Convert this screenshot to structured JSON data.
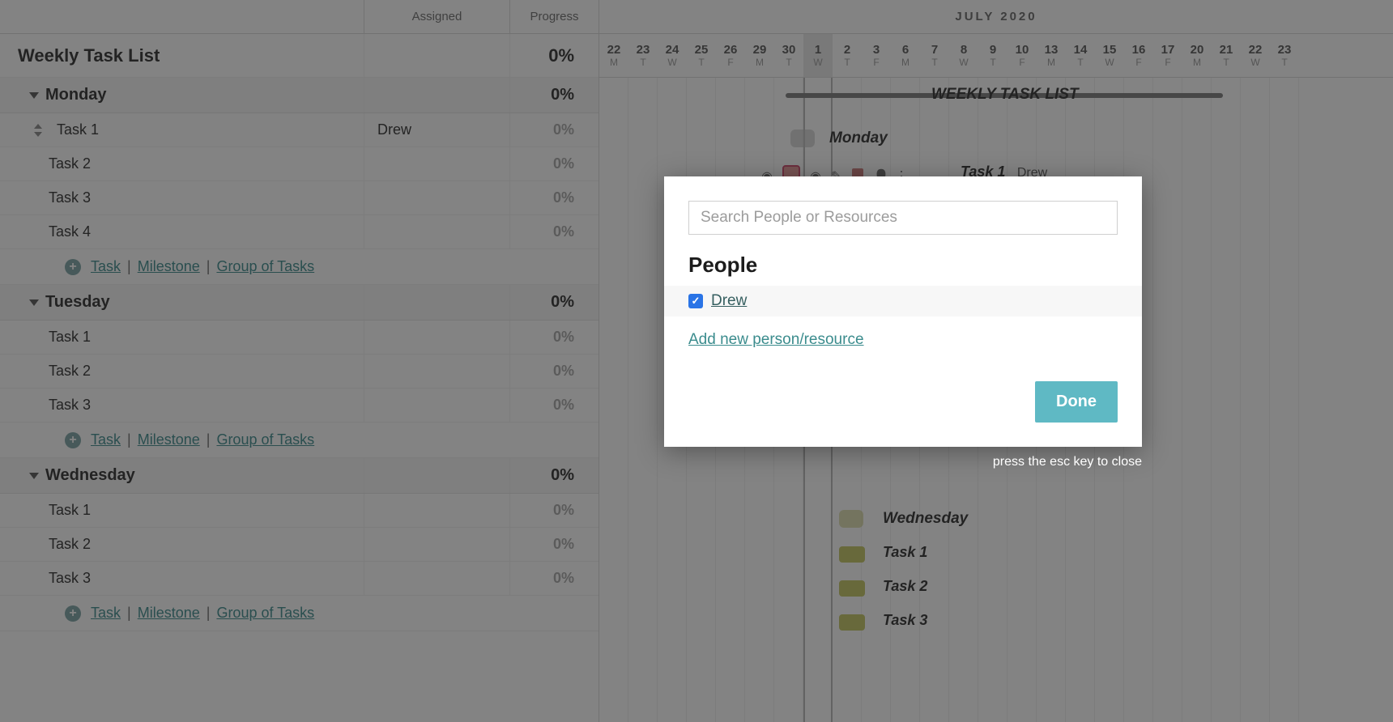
{
  "columns": {
    "assigned": "Assigned",
    "progress": "Progress"
  },
  "project": {
    "title": "Weekly Task List",
    "progress": "0%"
  },
  "days": [
    {
      "name": "Monday",
      "progress": "0%",
      "tasks": [
        {
          "name": "Task 1",
          "assigned": "Drew",
          "progress": "0%"
        },
        {
          "name": "Task 2",
          "assigned": "",
          "progress": "0%"
        },
        {
          "name": "Task 3",
          "assigned": "",
          "progress": "0%"
        },
        {
          "name": "Task 4",
          "assigned": "",
          "progress": "0%"
        }
      ]
    },
    {
      "name": "Tuesday",
      "progress": "0%",
      "tasks": [
        {
          "name": "Task 1",
          "assigned": "",
          "progress": "0%"
        },
        {
          "name": "Task 2",
          "assigned": "",
          "progress": "0%"
        },
        {
          "name": "Task 3",
          "assigned": "",
          "progress": "0%"
        }
      ]
    },
    {
      "name": "Wednesday",
      "progress": "0%",
      "tasks": [
        {
          "name": "Task 1",
          "assigned": "",
          "progress": "0%"
        },
        {
          "name": "Task 2",
          "assigned": "",
          "progress": "0%"
        },
        {
          "name": "Task 3",
          "assigned": "",
          "progress": "0%"
        }
      ]
    }
  ],
  "addRow": {
    "task": "Task",
    "milestone": "Milestone",
    "group": "Group of Tasks"
  },
  "timeline": {
    "month": "JULY 2020",
    "days": [
      {
        "n": "22",
        "w": "M"
      },
      {
        "n": "23",
        "w": "T"
      },
      {
        "n": "24",
        "w": "W"
      },
      {
        "n": "25",
        "w": "T"
      },
      {
        "n": "26",
        "w": "F"
      },
      {
        "n": "29",
        "w": "M"
      },
      {
        "n": "30",
        "w": "T"
      },
      {
        "n": "1",
        "w": "W"
      },
      {
        "n": "2",
        "w": "T"
      },
      {
        "n": "3",
        "w": "F"
      },
      {
        "n": "6",
        "w": "M"
      },
      {
        "n": "7",
        "w": "T"
      },
      {
        "n": "8",
        "w": "W"
      },
      {
        "n": "9",
        "w": "T"
      },
      {
        "n": "10",
        "w": "F"
      },
      {
        "n": "13",
        "w": "M"
      },
      {
        "n": "14",
        "w": "T"
      },
      {
        "n": "15",
        "w": "W"
      },
      {
        "n": "16",
        "w": "F"
      },
      {
        "n": "17",
        "w": "F"
      },
      {
        "n": "20",
        "w": "M"
      },
      {
        "n": "21",
        "w": "T"
      },
      {
        "n": "22",
        "w": "W"
      },
      {
        "n": "23",
        "w": "T"
      }
    ],
    "projectLabel": "WEEKLY TASK LIST",
    "monday": {
      "label": "Monday",
      "task1": "Task 1",
      "task1assigned": "Drew"
    },
    "wednesday": {
      "label": "Wednesday",
      "t1": "Task 1",
      "t2": "Task 2",
      "t3": "Task 3"
    }
  },
  "modal": {
    "searchPlaceholder": "Search People or Resources",
    "peopleTitle": "People",
    "people": [
      {
        "name": "Drew",
        "checked": true
      }
    ],
    "addLink": "Add new person/resource",
    "done": "Done",
    "escHint": "press the esc key to close"
  }
}
